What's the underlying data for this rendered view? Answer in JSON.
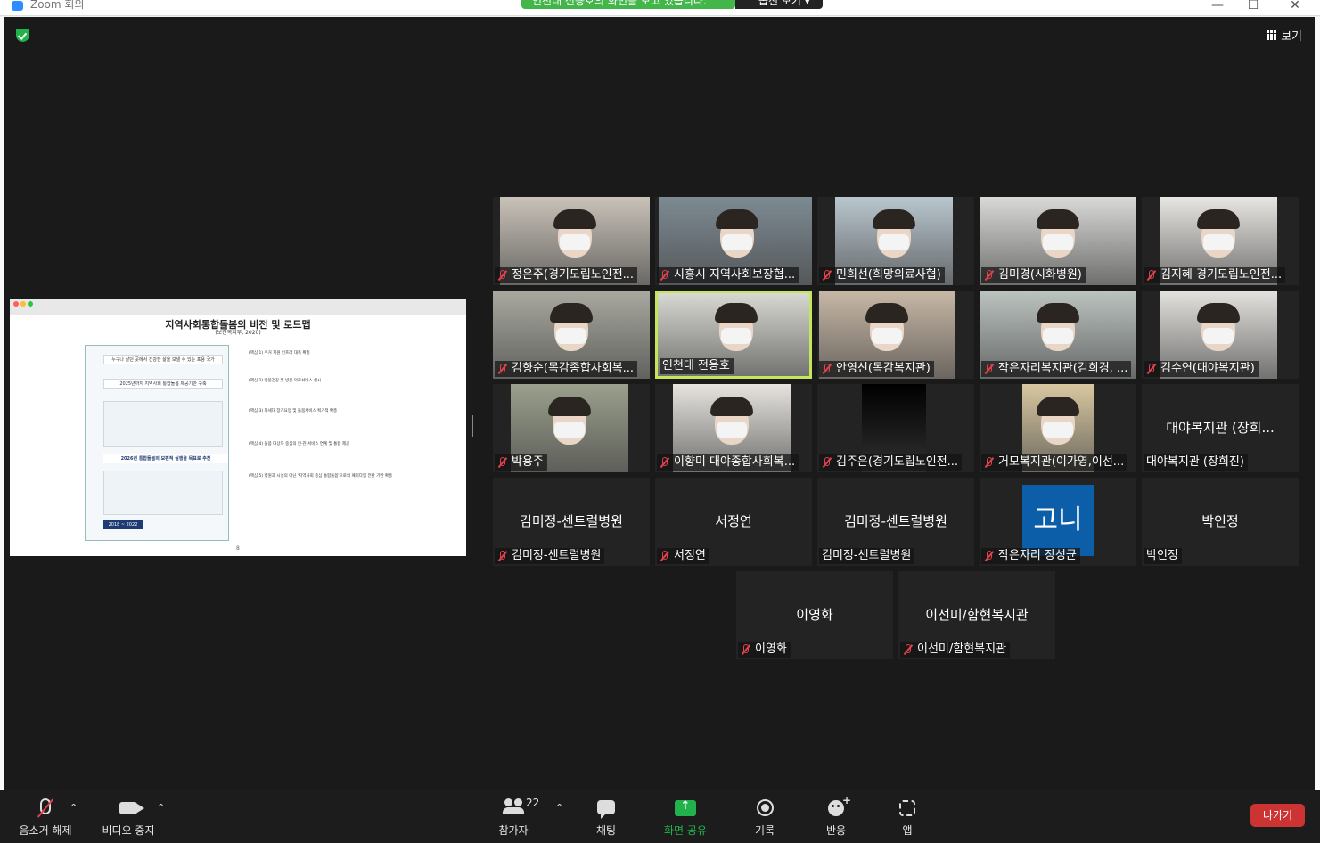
{
  "window": {
    "title": "Zoom 회의",
    "minimize": "—",
    "maximize": "☐",
    "close": "✕"
  },
  "notice": {
    "text": "인천대 전용호의 화면을 보고 있습니다.",
    "options": "옵션 보기 ▾"
  },
  "view_label": "보기",
  "shared": {
    "title": "지역사회통합돌봄의 비전 및 로드맵",
    "source": "(보건복지부, 2020)",
    "vision": "누구나 살던 곳에서 건강한 삶을 보낼 수 있는 포용 국가",
    "goal": "2025년까지 지역사회 통합돌봄 제공기반 구축",
    "target": "2026년 통합돌봄의 보편적 실행을 목표로 추진",
    "period": "2018 ~ 2022",
    "page": "8",
    "items": [
      "(핵심 1) 주거 지원 인프라 대폭 확충",
      "(핵심 2) 방문건강 및 방문 의료서비스 실시",
      "(핵심 3) 차세대 장기요양 및 돌봄서비스 획기적 확충",
      "(핵심 4) 돌봄 대상자 중심의 민·관 서비스 연계 및 통합 제공",
      "(핵심 5) 병원과 시설의 아닌 '지역사회 중심 통합돌봄'으로의 패러다임 전환 기반 확충"
    ]
  },
  "participants": [
    {
      "name": "정은주(경기도립노인전...",
      "video": true,
      "muted": true
    },
    {
      "name": "시흥시 지역사회보장협...",
      "video": true,
      "muted": true
    },
    {
      "name": "민희선(희망의료사협)",
      "video": true,
      "muted": true
    },
    {
      "name": "김미경(시화병원)",
      "video": true,
      "muted": true
    },
    {
      "name": "김지혜 경기도립노인전...",
      "video": true,
      "muted": true
    },
    {
      "name": "김향순(목감종합사회복...",
      "video": true,
      "muted": true
    },
    {
      "name": "인천대 전용호",
      "video": true,
      "muted": false,
      "active": true
    },
    {
      "name": "안영신(목감복지관)",
      "video": true,
      "muted": true
    },
    {
      "name": "작은자리복지관(김희경, ...",
      "video": true,
      "muted": true
    },
    {
      "name": "김수연(대야복지관)",
      "video": true,
      "muted": true
    },
    {
      "name": "박용주",
      "video": true,
      "muted": true
    },
    {
      "name": "이향미 대야종합사회복...",
      "video": true,
      "muted": true
    },
    {
      "name": "김주은(경기도립노인전...",
      "video": true,
      "muted": true
    },
    {
      "name": "거모복지관(이가영,이선...",
      "video": true,
      "muted": true
    },
    {
      "name": "대야복지관 (장희진)",
      "big": "대야복지관 (장희...",
      "muted": false
    },
    {
      "name": "김미정-센트럴병원",
      "big": "김미정-센트럴병원",
      "muted": true
    },
    {
      "name": "서정연",
      "big": "서정연",
      "muted": true
    },
    {
      "name": "김미정-센트럴병원",
      "big": "김미정-센트럴병원",
      "muted": false
    },
    {
      "name": "작은자리 장성균",
      "avatar": "고니",
      "muted": true
    },
    {
      "name": "박인정",
      "big": "박인정",
      "muted": false
    },
    {
      "name": "이영화",
      "big": "이영화",
      "muted": true
    },
    {
      "name": "이선미/함현복지관",
      "big": "이선미/함현복지관",
      "muted": true
    }
  ],
  "toolbar": {
    "unmute": "음소거 해제",
    "stop_video": "비디오 중지",
    "participants": "참가자",
    "participant_count": "22",
    "chat": "채팅",
    "share": "화면 공유",
    "record": "기록",
    "reactions": "반응",
    "apps": "앱",
    "leave": "나가기"
  },
  "colors": {
    "accent_green": "#22b24c",
    "active_speaker": "#c5e55b",
    "leave_red": "#cc3333",
    "muted_red": "#e0424b"
  }
}
